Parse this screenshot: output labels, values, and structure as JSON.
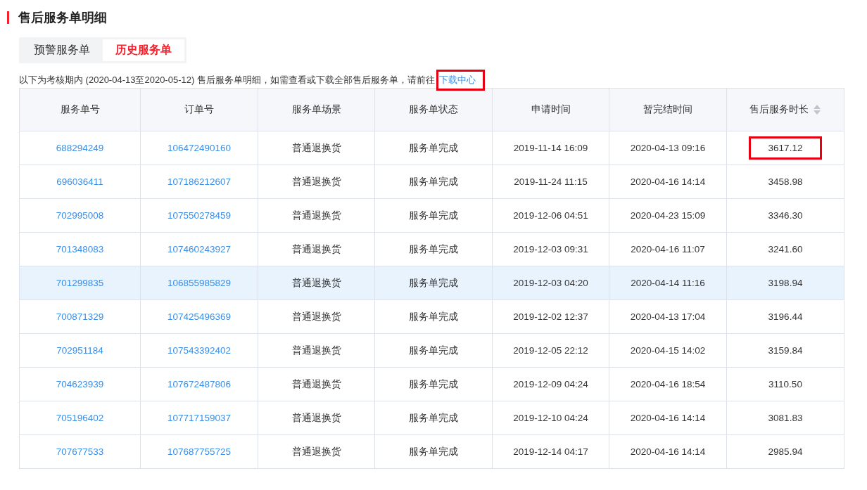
{
  "title": "售后服务单明细",
  "tabs": [
    {
      "label": "预警服务单",
      "selected": false
    },
    {
      "label": "历史服务单",
      "selected": true
    }
  ],
  "notice": {
    "text": "以下为考核期内 (2020-04-13至2020-05-12) 售后服务单明细，如需查看或下载全部售后服务单，请前往",
    "link": "下载中心",
    "link_highlighted": true
  },
  "table": {
    "columns": [
      "服务单号",
      "订单号",
      "服务单场景",
      "服务单状态",
      "申请时间",
      "暂完结时间",
      "售后服务时长"
    ],
    "rows": [
      {
        "selected": false,
        "duration_highlighted": true,
        "cells": [
          "688294249",
          "106472490160",
          "普通退换货",
          "服务单完成",
          "2019-11-14 16:09",
          "2020-04-13 09:16",
          "3617.12"
        ]
      },
      {
        "selected": false,
        "duration_highlighted": false,
        "cells": [
          "696036411",
          "107186212607",
          "普通退换货",
          "服务单完成",
          "2019-11-24 11:15",
          "2020-04-16 14:14",
          "3458.98"
        ]
      },
      {
        "selected": false,
        "duration_highlighted": false,
        "cells": [
          "702995008",
          "107550278459",
          "普通退换货",
          "服务单完成",
          "2019-12-06 04:51",
          "2020-04-23 15:09",
          "3346.30"
        ]
      },
      {
        "selected": false,
        "duration_highlighted": false,
        "cells": [
          "701348083",
          "107460243927",
          "普通退换货",
          "服务单完成",
          "2019-12-03 09:31",
          "2020-04-16 11:07",
          "3241.60"
        ]
      },
      {
        "selected": true,
        "duration_highlighted": false,
        "cells": [
          "701299835",
          "106855985829",
          "普通退换货",
          "服务单完成",
          "2019-12-03 04:20",
          "2020-04-14 11:16",
          "3198.94"
        ]
      },
      {
        "selected": false,
        "duration_highlighted": false,
        "cells": [
          "700871329",
          "107425496369",
          "普通退换货",
          "服务单完成",
          "2019-12-02 12:37",
          "2020-04-13 17:04",
          "3196.44"
        ]
      },
      {
        "selected": false,
        "duration_highlighted": false,
        "cells": [
          "702951184",
          "107543392402",
          "普通退换货",
          "服务单完成",
          "2019-12-05 22:12",
          "2020-04-15 14:02",
          "3159.84"
        ]
      },
      {
        "selected": false,
        "duration_highlighted": false,
        "cells": [
          "704623939",
          "107672487806",
          "普通退换货",
          "服务单完成",
          "2019-12-09 04:24",
          "2020-04-16 18:54",
          "3110.50"
        ]
      },
      {
        "selected": false,
        "duration_highlighted": false,
        "cells": [
          "705196402",
          "107717159037",
          "普通退换货",
          "服务单完成",
          "2019-12-10 04:24",
          "2020-04-16 14:14",
          "3081.83"
        ]
      },
      {
        "selected": false,
        "duration_highlighted": false,
        "cells": [
          "707677533",
          "107687755725",
          "普通退换货",
          "服务单完成",
          "2019-12-14 04:17",
          "2020-04-16 14:14",
          "2985.94"
        ]
      }
    ]
  }
}
